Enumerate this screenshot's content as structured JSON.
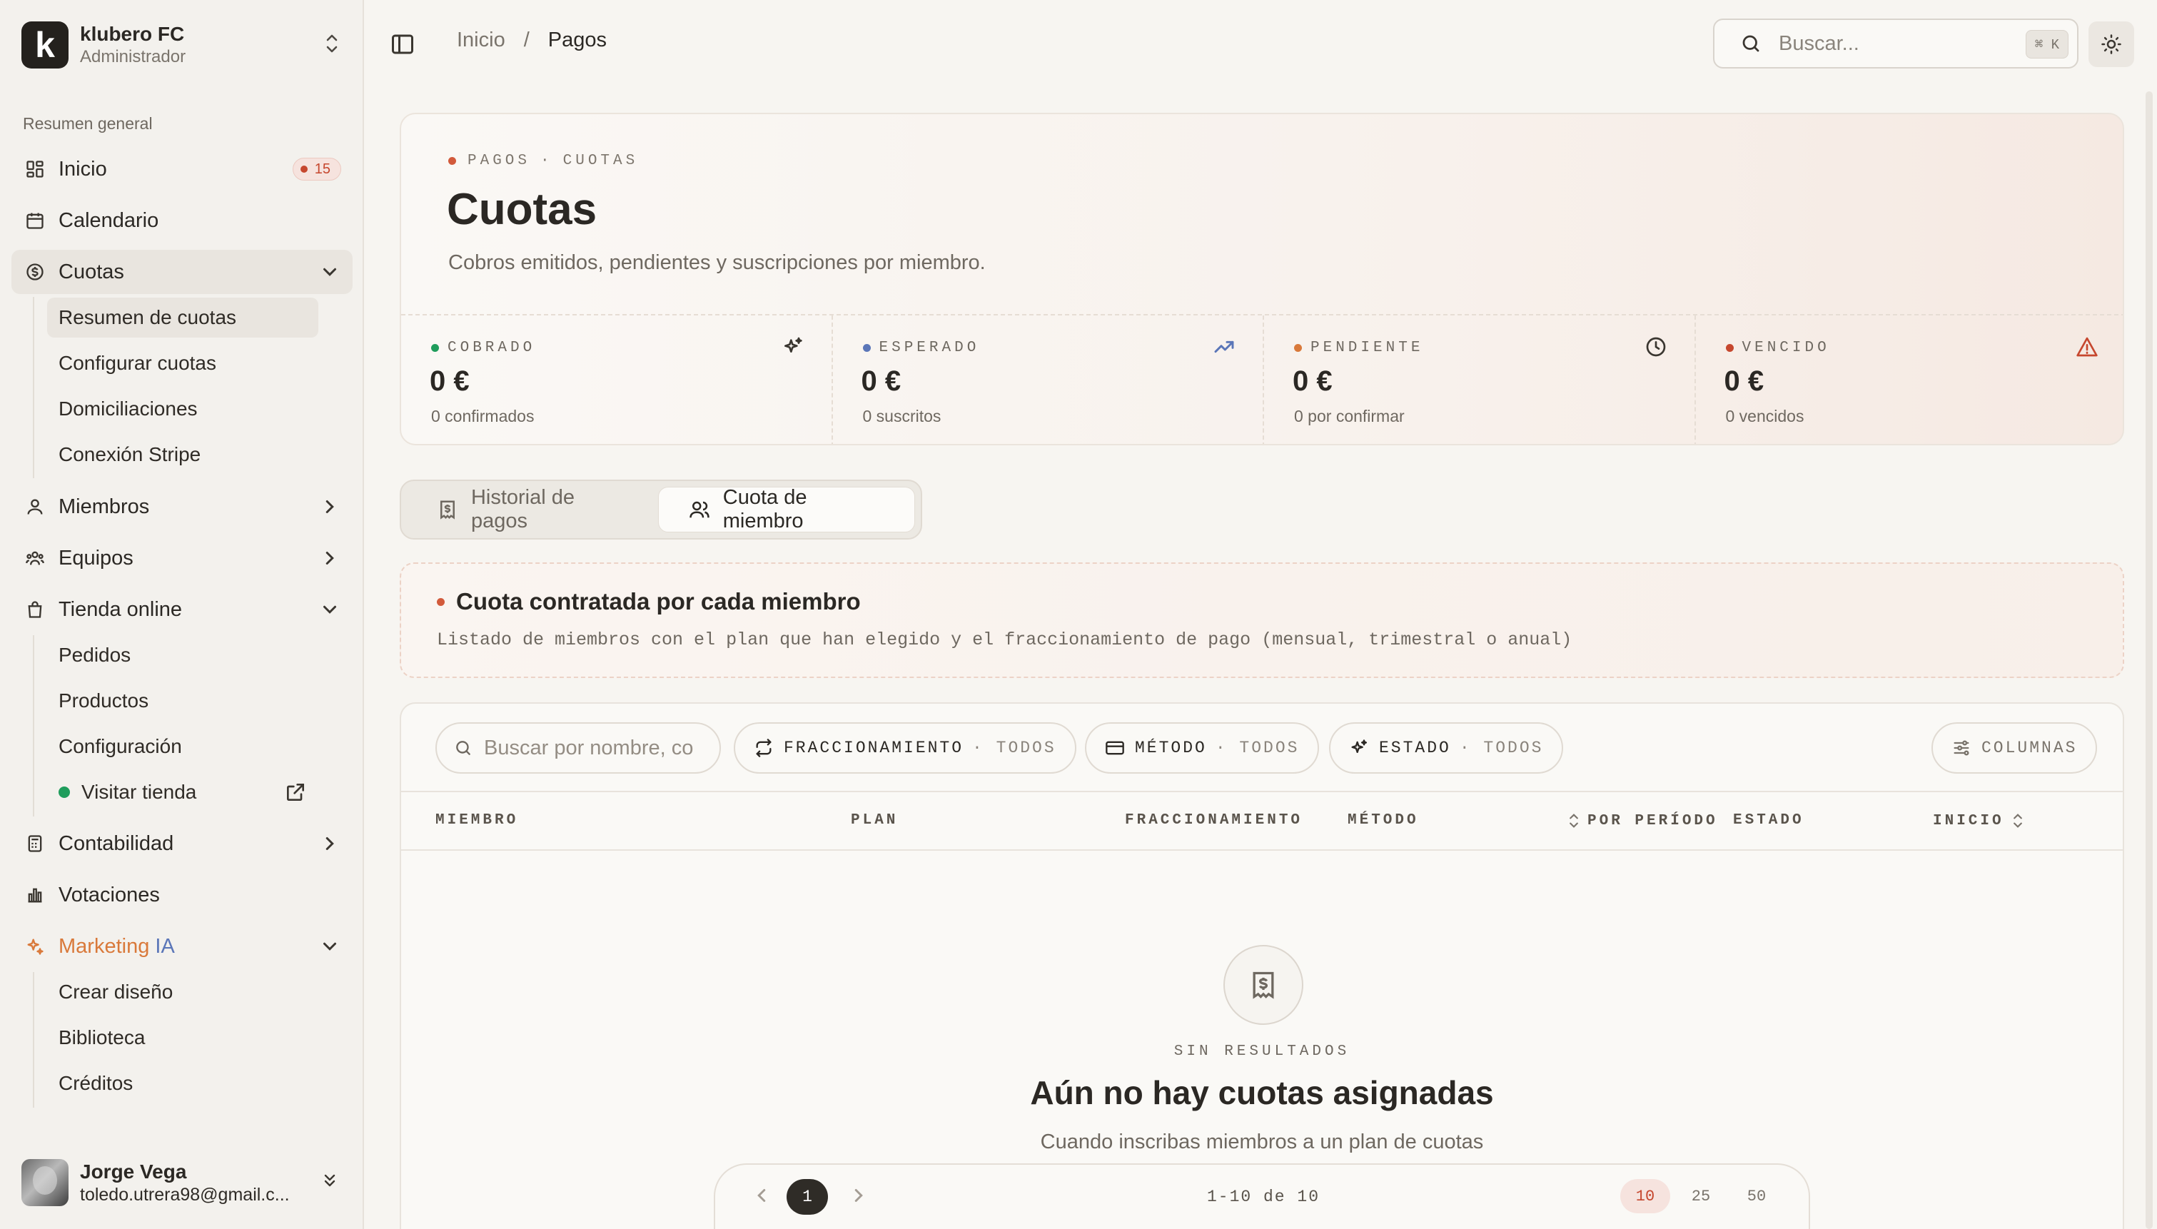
{
  "org": {
    "initial": "k",
    "name": "klubero FC",
    "role": "Administrador"
  },
  "sidebar": {
    "section_label": "Resumen general",
    "items": [
      {
        "label": "Inicio",
        "icon": "dashboard-icon",
        "badge": "15"
      },
      {
        "label": "Calendario",
        "icon": "calendar-icon"
      },
      {
        "label": "Cuotas",
        "icon": "dollar-circle-icon",
        "expanded": true,
        "children": [
          "Resumen de cuotas",
          "Configurar cuotas",
          "Domiciliaciones",
          "Conexión Stripe"
        ]
      },
      {
        "label": "Miembros",
        "icon": "user-icon"
      },
      {
        "label": "Equipos",
        "icon": "team-icon"
      },
      {
        "label": "Tienda online",
        "icon": "shopping-bag-icon",
        "expanded": true,
        "children": [
          "Pedidos",
          "Productos",
          "Configuración",
          "Visitar tienda"
        ]
      },
      {
        "label": "Contabilidad",
        "icon": "calculator-icon"
      },
      {
        "label": "Votaciones",
        "icon": "bar-chart-icon"
      },
      {
        "label_a": "Marketing",
        "label_b": "IA",
        "icon": "sparkles-icon",
        "expanded": true,
        "children": [
          "Crear diseño",
          "Biblioteca",
          "Créditos"
        ]
      }
    ]
  },
  "user": {
    "name": "Jorge Vega",
    "email": "toledo.utrera98@gmail.c..."
  },
  "breadcrumb": {
    "root": "Inicio",
    "separator": "/",
    "current": "Pagos"
  },
  "search": {
    "placeholder": "Buscar...",
    "shortcut": "⌘ K"
  },
  "hero": {
    "eyebrow_a": "PAGOS",
    "eyebrow_sep": "·",
    "eyebrow_b": "CUOTAS",
    "title": "Cuotas",
    "subtitle": "Cobros emitidos, pendientes y suscripciones por miembro."
  },
  "stats": [
    {
      "label": "COBRADO",
      "value": "0 €",
      "sub": "0 confirmados",
      "color": "#1f9d5c",
      "icon": "sparkles-icon"
    },
    {
      "label": "ESPERADO",
      "value": "0 €",
      "sub": "0 suscritos",
      "color": "#5b76b8",
      "icon": "trending-up-icon"
    },
    {
      "label": "PENDIENTE",
      "value": "0 €",
      "sub": "0 por confirmar",
      "color": "#d9793a",
      "icon": "clock-icon"
    },
    {
      "label": "VENCIDO",
      "value": "0 €",
      "sub": "0 vencidos",
      "color": "#c6472e",
      "icon": "warning-icon"
    }
  ],
  "tabs": [
    {
      "label": "Historial de pagos",
      "active": false
    },
    {
      "label": "Cuota de miembro",
      "active": true
    }
  ],
  "banner": {
    "title": "Cuota contratada por cada miembro",
    "subtitle": "Listado de miembros con el plan que han elegido y el fraccionamiento de pago (mensual, trimestral o anual)"
  },
  "filters": {
    "search_placeholder": "Buscar por nombre, co",
    "chips": [
      {
        "label": "FRACCIONAMIENTO",
        "value": "· TODOS"
      },
      {
        "label": "MÉTODO",
        "value": "· TODOS"
      },
      {
        "label": "ESTADO",
        "value": "· TODOS"
      }
    ],
    "columns_label": "COLUMNAS"
  },
  "table": {
    "columns": [
      "MIEMBRO",
      "PLAN",
      "FRACCIONAMIENTO",
      "MÉTODO",
      "POR PERÍODO",
      "ESTADO",
      "INICIO"
    ],
    "rows": []
  },
  "empty": {
    "eyebrow": "SIN RESULTADOS",
    "title": "Aún no hay cuotas asignadas",
    "subtitle": "Cuando inscribas miembros a un plan de cuotas"
  },
  "pagination": {
    "current_page": "1",
    "range": "1-10 de 10",
    "sizes": [
      "10",
      "25",
      "50"
    ],
    "active_size": "10"
  },
  "colors": {
    "accent": "#d25a3b",
    "badge_red": "#c6472e",
    "marketing_orange": "#d9793a",
    "marketing_blue": "#5b76b8",
    "online_green": "#1f9d5c"
  }
}
